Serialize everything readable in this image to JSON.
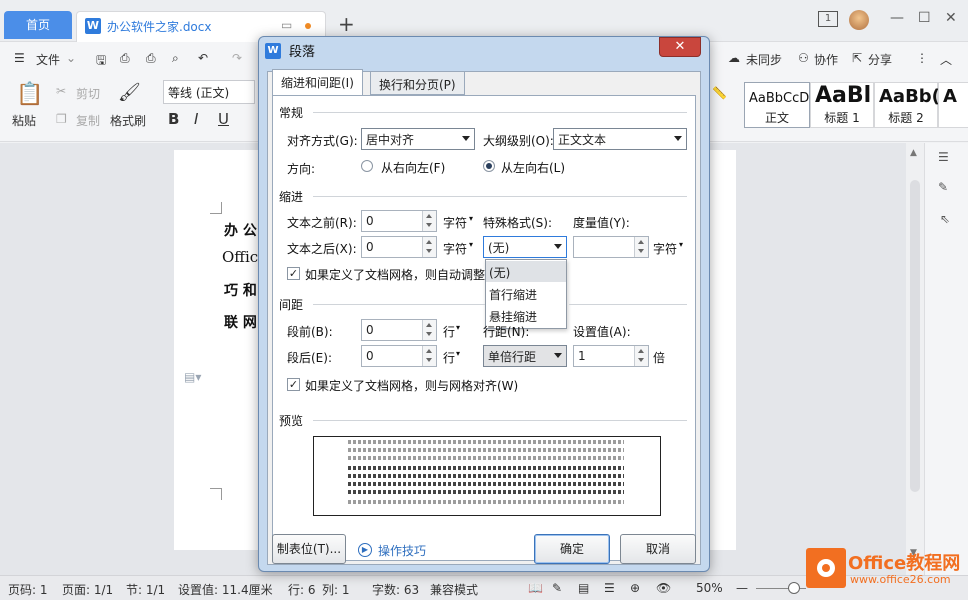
{
  "titlebar": {
    "home_tab": "首页",
    "doc_tab": "办公软件之家.docx",
    "page_count": "1"
  },
  "menubar": {
    "file": "文件",
    "sync": "未同步",
    "collab": "协作",
    "share": "分享"
  },
  "ribbon": {
    "paste": "粘贴",
    "cut": "剪切",
    "copy": "复制",
    "format_painter": "格式刷",
    "font": "等线 (正文)",
    "styles": [
      {
        "sample": "AaBbCcD",
        "name": "正文"
      },
      {
        "sample": "AaBl",
        "name": "标题 1"
      },
      {
        "sample": "AaBb(",
        "name": "标题 2"
      },
      {
        "sample": "A",
        "name": ""
      }
    ]
  },
  "document": {
    "lines": [
      "办 公",
      "Offic",
      "巧 和",
      "联 网"
    ]
  },
  "statusbar": {
    "page": "页码: 1",
    "pages": "页面: 1/1",
    "section": "节: 1/1",
    "setting": "设置值: 11.4厘米",
    "row": "行: 6",
    "col": "列: 1",
    "words": "字数: 63",
    "mode": "兼容模式",
    "zoom": "50%"
  },
  "logo": {
    "name": "Office教程网",
    "url": "www.office26.com"
  },
  "dialog": {
    "title": "段落",
    "tabs": [
      "缩进和间距(I)",
      "换行和分页(P)"
    ],
    "general": {
      "section": "常规",
      "align_label": "对齐方式(G):",
      "align_value": "居中对齐",
      "outline_label": "大纲级别(O):",
      "outline_value": "正文文本",
      "direction_label": "方向:",
      "rtl": "从右向左(F)",
      "ltr": "从左向右(L)"
    },
    "indent": {
      "section": "缩进",
      "before_label": "文本之前(R):",
      "before_value": "0",
      "before_unit": "字符",
      "after_label": "文本之后(X):",
      "after_value": "0",
      "after_unit": "字符",
      "special_label": "特殊格式(S):",
      "special_value": "(无)",
      "measure_label": "度量值(Y):",
      "measure_unit": "字符",
      "grid_check": "如果定义了文档网格，则自动调整",
      "special_options": [
        "(无)",
        "首行缩进",
        "悬挂缩进"
      ]
    },
    "spacing": {
      "section": "间距",
      "before_label": "段前(B):",
      "before_value": "0",
      "before_unit": "行",
      "after_label": "段后(E):",
      "after_value": "0",
      "after_unit": "行",
      "line_label": "行距(N):",
      "line_value": "单倍行距",
      "setting_label": "设置值(A):",
      "setting_value": "1",
      "setting_unit": "倍",
      "grid_check": "如果定义了文档网格，则与网格对齐(W)"
    },
    "preview": {
      "section": "预览"
    },
    "buttons": {
      "tabs": "制表位(T)...",
      "tips": "操作技巧",
      "ok": "确定",
      "cancel": "取消"
    }
  }
}
